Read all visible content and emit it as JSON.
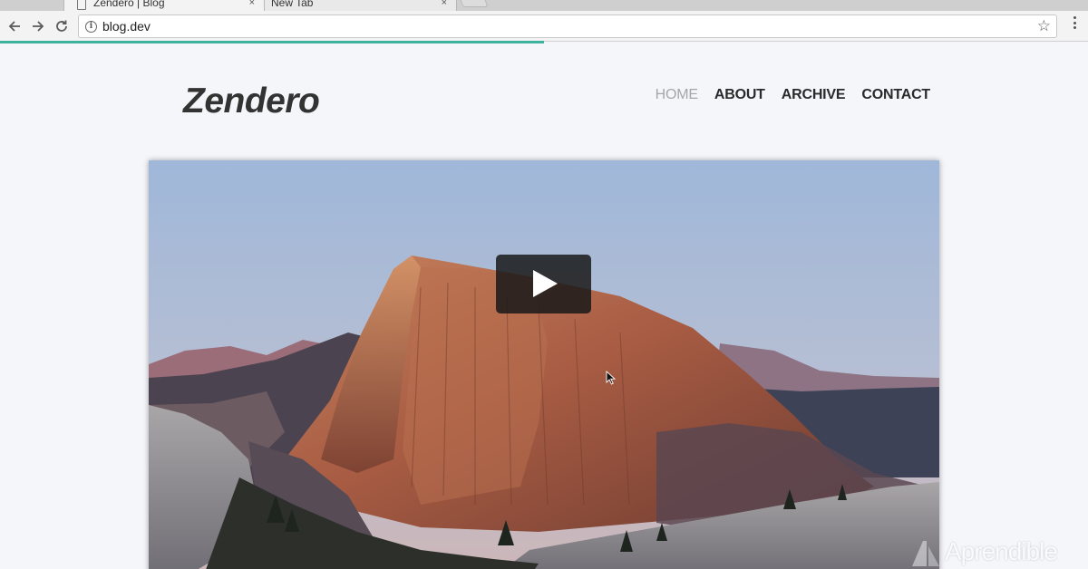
{
  "browser": {
    "tabs": [
      {
        "title": "Zendero | Blog",
        "active": true
      },
      {
        "title": "New Tab",
        "active": false
      }
    ],
    "close_glyph": "×",
    "url": "blog.dev",
    "load_progress": 0.5,
    "icons": [
      "back-arrow-icon",
      "forward-arrow-icon",
      "reload-icon",
      "info-icon",
      "star-icon",
      "kebab-menu-icon"
    ],
    "accent": "#3fb19c"
  },
  "site": {
    "logo": "Zendero",
    "nav": [
      {
        "label": "HOME",
        "current": true
      },
      {
        "label": "ABOUT",
        "current": false
      },
      {
        "label": "ARCHIVE",
        "current": false
      },
      {
        "label": "CONTACT",
        "current": false
      }
    ]
  },
  "hero": {
    "media": "video",
    "play_icon": "play-icon"
  },
  "watermark": {
    "text": "Aprendible"
  }
}
